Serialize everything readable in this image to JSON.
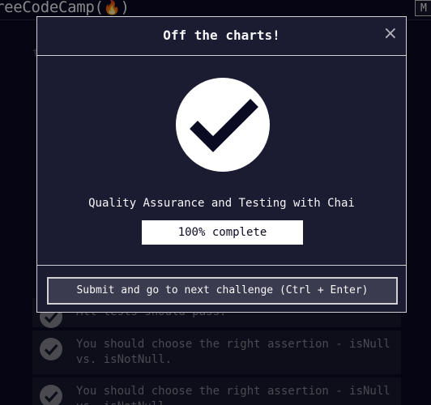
{
  "navbar": {
    "brand": "reeCodeCamp(",
    "brand_flame": "🔥",
    "brand_close": ")",
    "menu_label": "M"
  },
  "background": {
    "partial_text": "t",
    "tests": [
      {
        "text": "All tests should pass."
      },
      {
        "text": "You should choose the right assertion - isNull vs. isNotNull."
      },
      {
        "text": "You should choose the right assertion - isNull vs. isNotNull."
      }
    ]
  },
  "modal": {
    "title": "Off the charts!",
    "close_label": "×",
    "certification": "Quality Assurance and Testing with Chai",
    "progress_text": "100% complete",
    "progress_percent": 100,
    "submit_label": "Submit and go to next challenge (Ctrl + Enter)"
  },
  "colors": {
    "background": "#0a0a23",
    "panel": "#1b1b32",
    "text": "#f5f6f7",
    "border": "#d0d0d5",
    "button": "#3b3b4f"
  }
}
